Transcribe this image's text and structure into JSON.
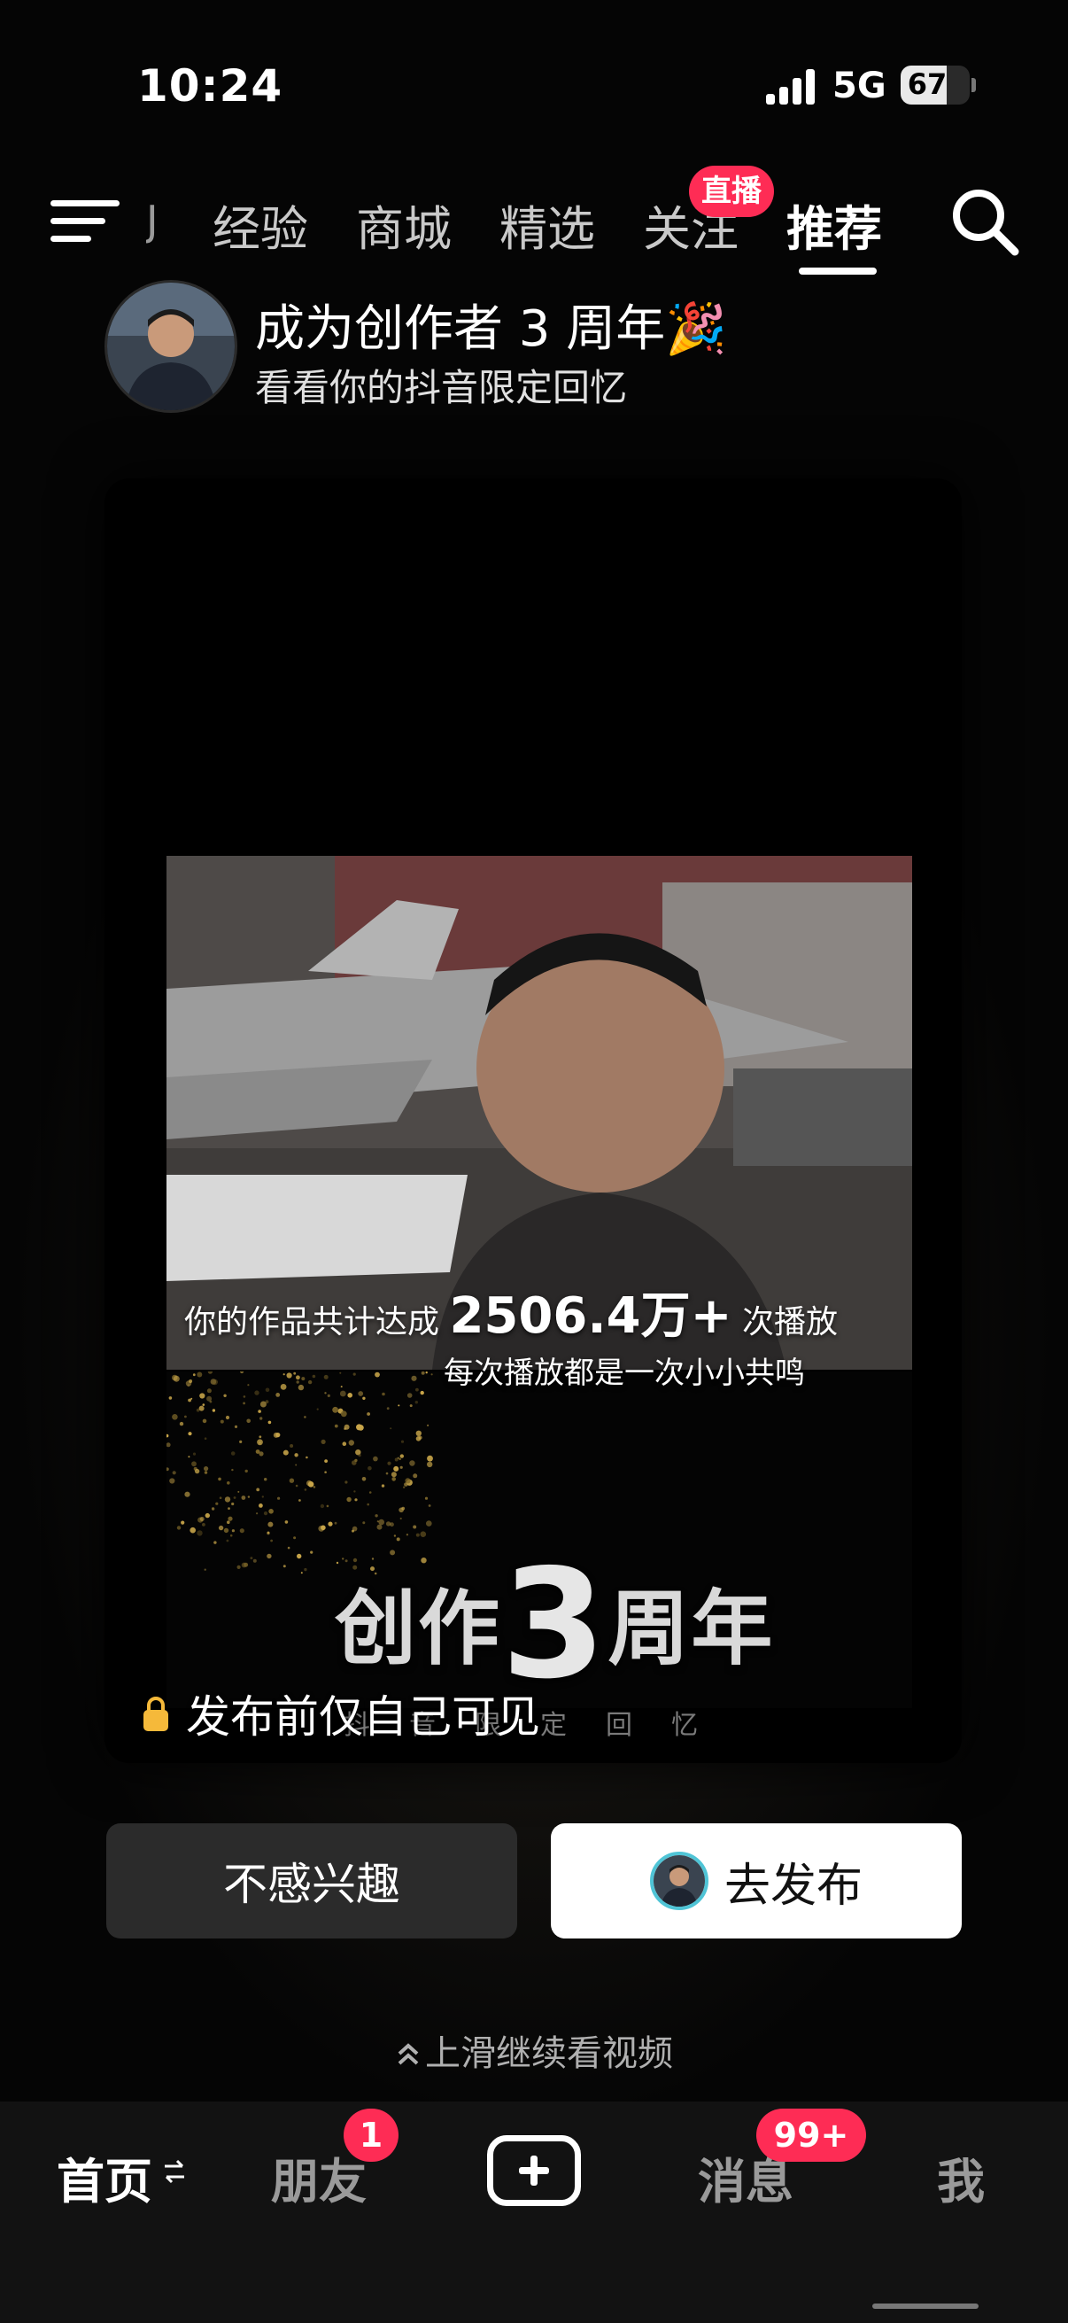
{
  "status_bar": {
    "time": "10:24",
    "network": "5G",
    "battery": "67",
    "battery_level": 0.67
  },
  "top_nav": {
    "partial_tab": "J",
    "tabs": [
      "经验",
      "商城",
      "精选",
      "关注",
      "推荐"
    ],
    "active_tab": "推荐",
    "live_badge": "直播"
  },
  "creator": {
    "title": "成为创作者 3 周年🎉",
    "subtitle": "看看你的抖音限定回忆"
  },
  "card": {
    "caption_prefix": "你的作品共计达成",
    "caption_value": "2506.4万+",
    "caption_suffix": "次播放",
    "caption_sub": "每次播放都是一次小小共鸣",
    "anniversary_pre": "创作",
    "anniversary_num": "3",
    "anniversary_post": "周年",
    "faint_text": "抖音限定回忆",
    "privacy_note": "发布前仅自己可见"
  },
  "actions": {
    "dismiss_label": "不感兴趣",
    "publish_label": "去发布"
  },
  "swipe_hint": "上滑继续看视频",
  "bottom_nav": {
    "home": "首页",
    "friends": "朋友",
    "friends_badge": "1",
    "messages": "消息",
    "messages_badge": "99+",
    "me": "我"
  },
  "colors": {
    "accent": "#fe2c55",
    "background": "#000000",
    "ring": "#4fc4d6"
  }
}
